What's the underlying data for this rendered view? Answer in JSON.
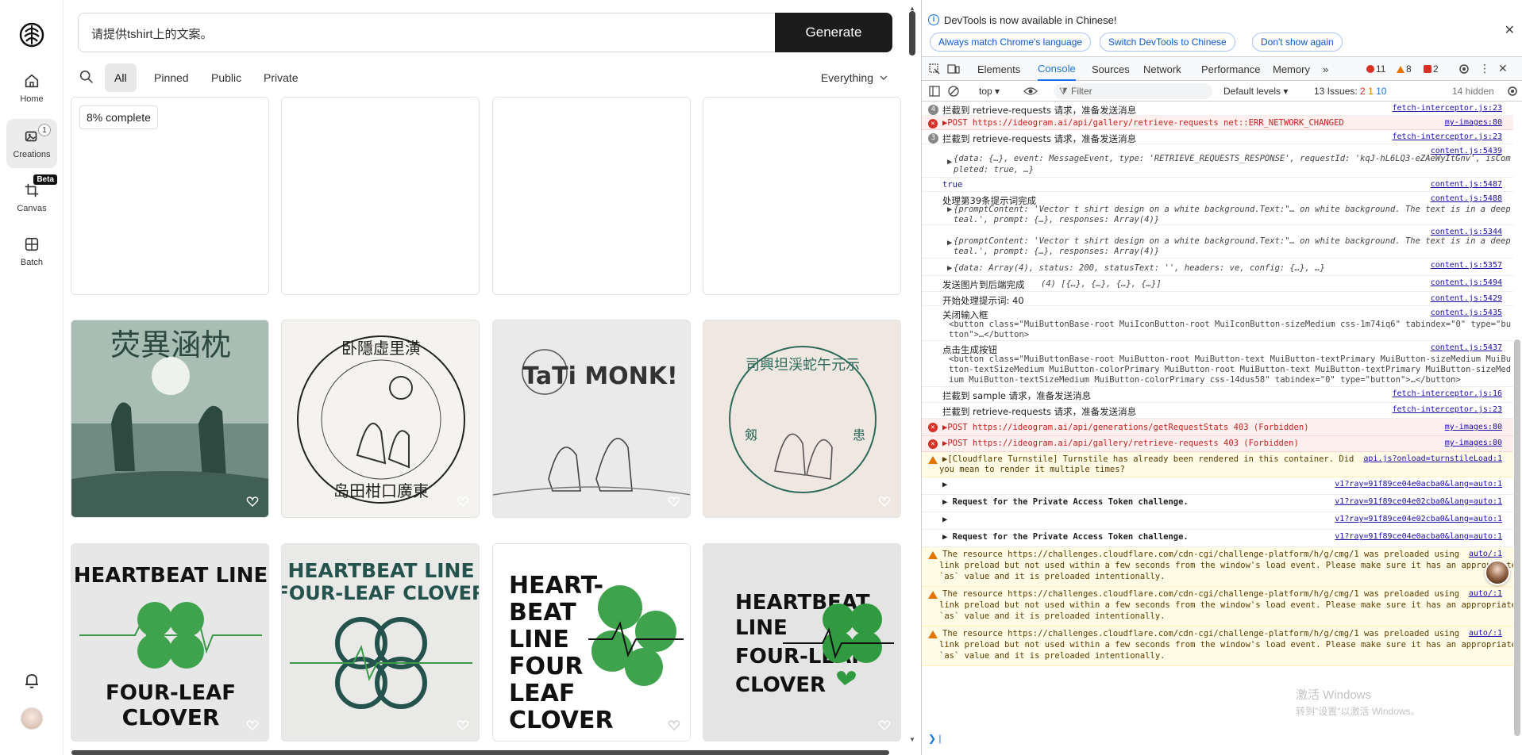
{
  "nav": {
    "home_label": "Home",
    "creations_label": "Creations",
    "creations_badge": "1",
    "canvas_label": "Canvas",
    "canvas_badge": "Beta",
    "batch_label": "Batch"
  },
  "prompt": {
    "value": "请提供tshirt上的文案。",
    "generate_label": "Generate"
  },
  "filters": {
    "tabs": [
      "All",
      "Pinned",
      "Public",
      "Private"
    ],
    "active": "All",
    "scope": "Everything"
  },
  "gallery": {
    "progress": "8% complete",
    "row2_texts": [
      "荧異涵枕",
      "TaTi MONK!",
      "HEARTBEAT LINE FOUR-LEAF CLOVER"
    ],
    "row3_titles": [
      {
        "top": "HEARTBEAT LINE",
        "bottom": "FOUR-LEAF CLOVER"
      },
      {
        "top": "HEARTBEAT LINE",
        "bottom": "FOUR-LEAF CLOVER"
      },
      {
        "top": "HEART-BEAT LINE FOUR LEAF CLOVER",
        "bottom": ""
      },
      {
        "top": "HEARTBEAT LINE",
        "bottom": "FOUR-LEAF CLOVER"
      }
    ]
  },
  "devtools": {
    "banner_text": "DevTools is now available in Chinese!",
    "banner_buttons": [
      "Always match Chrome's language",
      "Switch DevTools to Chinese",
      "Don't show again"
    ],
    "tabs": [
      "Elements",
      "Console",
      "Sources",
      "Network",
      "Performance",
      "Memory"
    ],
    "active_tab": "Console",
    "errors": "11",
    "warnings": "8",
    "issues_small": "2",
    "context": "top",
    "filter_placeholder": "Filter",
    "levels": "Default levels",
    "issues_label": "13 Issues:",
    "issues_err": "2",
    "issues_warn": "1",
    "issues_info": "10",
    "hidden": "14 hidden"
  },
  "console_rows": [
    {
      "kind": "num",
      "n": "4",
      "text": "拦截到 retrieve-requests 请求，准备发送消息",
      "src": "fetch-interceptor.js:23"
    },
    {
      "kind": "err",
      "text": "▶POST https://ideogram.ai/api/gallery/retrieve-requests net::ERR_NETWORK_CHANGED",
      "src": "my-images:80"
    },
    {
      "kind": "num",
      "n": "3",
      "text": "拦截到 retrieve-requests 请求，准备发送消息",
      "src": "fetch-interceptor.js:23"
    },
    {
      "kind": "log",
      "text": "",
      "src": "content.js:5439"
    },
    {
      "kind": "log",
      "text": "true",
      "src": "content.js:5487"
    },
    {
      "kind": "log",
      "text": "处理第39条提示词完成",
      "src": "content.js:5488"
    },
    {
      "kind": "log",
      "text": "",
      "src": "content.js:5344"
    },
    {
      "kind": "log",
      "text": "",
      "src": "content.js:5357"
    },
    {
      "kind": "log",
      "text": "发送图片到后端完成",
      "src": "content.js:5494"
    },
    {
      "kind": "log",
      "text": "开始处理提示词: 40",
      "src": "content.js:5429"
    },
    {
      "kind": "log",
      "text": "关闭输入框",
      "src": "content.js:5435"
    },
    {
      "kind": "log",
      "text": "点击生成按钮",
      "src": "content.js:5437"
    },
    {
      "kind": "log",
      "text": "拦截到 sample 请求，准备发送消息",
      "src": "fetch-interceptor.js:16"
    },
    {
      "kind": "log",
      "text": "拦截到 retrieve-requests 请求，准备发送消息",
      "src": "fetch-interceptor.js:23"
    },
    {
      "kind": "err",
      "text": "▶POST https://ideogram.ai/api/generations/getRequestStats 403 (Forbidden)",
      "src": "my-images:80"
    },
    {
      "kind": "err",
      "text": "▶POST https://ideogram.ai/api/gallery/retrieve-requests 403 (Forbidden)",
      "src": "my-images:80"
    },
    {
      "kind": "warn",
      "text": "▶[Cloudflare Turnstile] Turnstile has already been rendered in this container. Did",
      "text2": "you mean to render it multiple times?",
      "src": "api.js?onload=turnstileLoad:1"
    },
    {
      "kind": "log",
      "text": "▶",
      "src": "v1?ray=91f89ce04e0acba0&lang=auto:1"
    },
    {
      "kind": "log",
      "text": "▶ Request for the Private Access Token challenge.",
      "src": "v1?ray=91f89ce04e02cba0&lang=auto:1"
    },
    {
      "kind": "log",
      "text": "▶",
      "src": "v1?ray=91f89ce04e02cba0&lang=auto:1"
    },
    {
      "kind": "log",
      "text": "▶ Request for the Private Access Token challenge.",
      "src": "v1?ray=91f89ce04e0acba0&lang=auto:1"
    },
    {
      "kind": "warn",
      "text": "The resource https://challenges.cloudflare.com/cdn-cgi/challenge-platform/h/g/cmg/1 was preloaded using",
      "text2": "link preload but not used within a few seconds from the window's load event. Please make sure it has an appropriate",
      "text3": "`as` value and it is preloaded intentionally.",
      "src": "auto/:1"
    },
    {
      "kind": "warn",
      "text": "The resource https://challenges.cloudflare.com/cdn-cgi/challenge-platform/h/g/cmg/1 was preloaded using",
      "text2": "link preload but not used within a few seconds from the window's load event. Please make sure it has an appropriate",
      "text3": "`as` value and it is preloaded intentionally.",
      "src": "auto/:1"
    },
    {
      "kind": "warn",
      "text": "The resource https://challenges.cloudflare.com/cdn-cgi/challenge-platform/h/g/cmg/1 was preloaded using",
      "text2": "link preload but not used within a few seconds from the window's load event. Please make sure it has an appropriate",
      "text3": "`as` value and it is preloaded intentionally.",
      "src": "auto/:1"
    }
  ],
  "console_details": {
    "event_obj": "{data: {…}, event: MessageEvent, type: 'RETRIEVE_REQUESTS_RESPONSE', requestId: 'kqJ-hL6LQ3-eZAeWyItGnv', isCom",
    "event_obj2": "pleted: true, …}",
    "prompt_obj": "{promptContent: 'Vector t shirt design on a white background.Text:\"… on white background. The text is in a deep",
    "prompt_obj2": "teal.', prompt: {…}, responses: Array(4)}",
    "resp_obj": "{data: Array(4), status: 200, statusText: '', headers: ve, config: {…}, …}",
    "upload_arr": "(4) [{…}, {…}, {…}, {…}]",
    "close_btn": "<button class=\"MuiButtonBase-root MuiIconButton-root MuiIconButton-sizeMedium css-1m74iq6\" tabindex=\"0\" type=\"bu",
    "close_btn2": "tton\">…</button>",
    "gen_btn": "<button class=\"MuiButtonBase-root MuiButton-root MuiButton-text MuiButton-textPrimary MuiButton-sizeMedium MuiBu",
    "gen_btn2": "tton-textSizeMedium MuiButton-colorPrimary MuiButton-root MuiButton-text MuiButton-textPrimary MuiButton-sizeMed",
    "gen_btn3": "ium MuiButton-textSizeMedium MuiButton-colorPrimary css-14dus58\" tabindex=\"0\" type=\"button\">…</button>",
    "flex": "flex"
  },
  "watermark": {
    "line1": "激活 Windows",
    "line2": "转到\"设置\"以激活 Windows。"
  },
  "colors": {
    "accent": "#1a73e8",
    "generate_bg": "#1c1c1c",
    "error": "#d93025",
    "warning": "#e37400"
  }
}
